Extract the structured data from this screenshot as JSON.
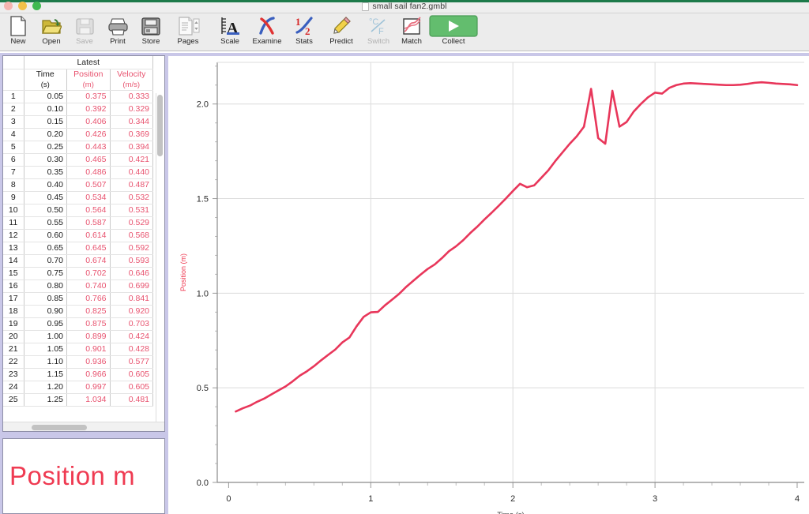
{
  "window": {
    "doc_title": "small sail fan2.gmbl",
    "doc_icon": "document-icon",
    "traffic_lights": [
      "close-red",
      "minimize-yellow",
      "maximize-green"
    ]
  },
  "toolbar": {
    "items": [
      {
        "label": "New",
        "icon": "new-document-icon",
        "disabled": false
      },
      {
        "label": "Open",
        "icon": "open-folder-icon",
        "disabled": false
      },
      {
        "label": "Save",
        "icon": "save-disk-icon",
        "disabled": true
      },
      {
        "label": "Print",
        "icon": "printer-icon",
        "disabled": false
      },
      {
        "label": "Store",
        "icon": "store-drive-icon",
        "disabled": false
      },
      {
        "label": "Pages",
        "icon": "pages-stepper-icon",
        "disabled": false
      },
      {
        "label": "Scale",
        "icon": "scale-axis-icon",
        "disabled": false
      },
      {
        "label": "Examine",
        "icon": "examine-cross-icon",
        "disabled": false
      },
      {
        "label": "Stats",
        "icon": "stats-half-icon",
        "disabled": false
      },
      {
        "label": "Predict",
        "icon": "pencil-icon",
        "disabled": false
      },
      {
        "label": "Switch",
        "icon": "switch-units-icon",
        "disabled": true
      },
      {
        "label": "Match",
        "icon": "match-graph-icon",
        "disabled": false
      },
      {
        "label": "Collect",
        "icon": "play-collect-icon",
        "disabled": false
      }
    ]
  },
  "table": {
    "group_header": "Latest",
    "columns": [
      {
        "name": "Time",
        "unit": "(s)",
        "color": "#1a1a1a"
      },
      {
        "name": "Position",
        "unit": "(m)",
        "color": "#e8536f"
      },
      {
        "name": "Velocity",
        "unit": "(m/s)",
        "color": "#e8536f"
      }
    ],
    "rows": [
      {
        "n": "1",
        "time": "0.05",
        "position": "0.375",
        "velocity": "0.333"
      },
      {
        "n": "2",
        "time": "0.10",
        "position": "0.392",
        "velocity": "0.329"
      },
      {
        "n": "3",
        "time": "0.15",
        "position": "0.406",
        "velocity": "0.344"
      },
      {
        "n": "4",
        "time": "0.20",
        "position": "0.426",
        "velocity": "0.369"
      },
      {
        "n": "5",
        "time": "0.25",
        "position": "0.443",
        "velocity": "0.394"
      },
      {
        "n": "6",
        "time": "0.30",
        "position": "0.465",
        "velocity": "0.421"
      },
      {
        "n": "7",
        "time": "0.35",
        "position": "0.486",
        "velocity": "0.440"
      },
      {
        "n": "8",
        "time": "0.40",
        "position": "0.507",
        "velocity": "0.487"
      },
      {
        "n": "9",
        "time": "0.45",
        "position": "0.534",
        "velocity": "0.532"
      },
      {
        "n": "10",
        "time": "0.50",
        "position": "0.564",
        "velocity": "0.531"
      },
      {
        "n": "11",
        "time": "0.55",
        "position": "0.587",
        "velocity": "0.529"
      },
      {
        "n": "12",
        "time": "0.60",
        "position": "0.614",
        "velocity": "0.568"
      },
      {
        "n": "13",
        "time": "0.65",
        "position": "0.645",
        "velocity": "0.592"
      },
      {
        "n": "14",
        "time": "0.70",
        "position": "0.674",
        "velocity": "0.593"
      },
      {
        "n": "15",
        "time": "0.75",
        "position": "0.702",
        "velocity": "0.646"
      },
      {
        "n": "16",
        "time": "0.80",
        "position": "0.740",
        "velocity": "0.699"
      },
      {
        "n": "17",
        "time": "0.85",
        "position": "0.766",
        "velocity": "0.841"
      },
      {
        "n": "18",
        "time": "0.90",
        "position": "0.825",
        "velocity": "0.920"
      },
      {
        "n": "19",
        "time": "0.95",
        "position": "0.875",
        "velocity": "0.703"
      },
      {
        "n": "20",
        "time": "1.00",
        "position": "0.899",
        "velocity": "0.424"
      },
      {
        "n": "21",
        "time": "1.05",
        "position": "0.901",
        "velocity": "0.428"
      },
      {
        "n": "22",
        "time": "1.10",
        "position": "0.936",
        "velocity": "0.577"
      },
      {
        "n": "23",
        "time": "1.15",
        "position": "0.966",
        "velocity": "0.605"
      },
      {
        "n": "24",
        "time": "1.20",
        "position": "0.997",
        "velocity": "0.605"
      },
      {
        "n": "25",
        "time": "1.25",
        "position": "1.034",
        "velocity": "0.481"
      }
    ]
  },
  "meter": {
    "label": "Position  m",
    "color": "#ef3b52"
  },
  "chart_data": {
    "type": "line",
    "title": "",
    "xlabel": "Time (s)",
    "ylabel": "Position (m)",
    "xlim": [
      -0.08,
      4.05
    ],
    "ylim": [
      0.0,
      2.22
    ],
    "xticks": [
      "0",
      "1",
      "2",
      "3",
      "4"
    ],
    "xtick_values": [
      0,
      1,
      2,
      3,
      4
    ],
    "yticks": [
      "0.0",
      "0.5",
      "1.0",
      "1.5",
      "2.0"
    ],
    "ytick_values": [
      0.0,
      0.5,
      1.0,
      1.5,
      2.0
    ],
    "grid": true,
    "legend": "none",
    "series": [
      {
        "name": "Position",
        "color": "#e8365a",
        "x": [
          0.05,
          0.1,
          0.15,
          0.2,
          0.25,
          0.3,
          0.35,
          0.4,
          0.45,
          0.5,
          0.55,
          0.6,
          0.65,
          0.7,
          0.75,
          0.8,
          0.85,
          0.9,
          0.95,
          1.0,
          1.05,
          1.1,
          1.15,
          1.2,
          1.25,
          1.3,
          1.35,
          1.4,
          1.45,
          1.5,
          1.55,
          1.6,
          1.65,
          1.7,
          1.75,
          1.8,
          1.85,
          1.9,
          1.95,
          2.0,
          2.05,
          2.1,
          2.15,
          2.2,
          2.25,
          2.3,
          2.35,
          2.4,
          2.45,
          2.5,
          2.55,
          2.6,
          2.65,
          2.7,
          2.75,
          2.8,
          2.85,
          2.9,
          2.95,
          3.0,
          3.05,
          3.1,
          3.15,
          3.2,
          3.25,
          3.3,
          3.35,
          3.4,
          3.45,
          3.5,
          3.55,
          3.6,
          3.65,
          3.7,
          3.75,
          3.8,
          3.85,
          3.9,
          3.95,
          4.0
        ],
        "y": [
          0.375,
          0.392,
          0.406,
          0.426,
          0.443,
          0.465,
          0.486,
          0.507,
          0.534,
          0.564,
          0.587,
          0.614,
          0.645,
          0.674,
          0.702,
          0.74,
          0.766,
          0.825,
          0.875,
          0.899,
          0.901,
          0.936,
          0.966,
          0.997,
          1.034,
          1.066,
          1.098,
          1.128,
          1.152,
          1.185,
          1.222,
          1.248,
          1.28,
          1.318,
          1.352,
          1.39,
          1.425,
          1.462,
          1.5,
          1.54,
          1.578,
          1.56,
          1.57,
          1.61,
          1.65,
          1.7,
          1.745,
          1.79,
          1.83,
          1.88,
          2.08,
          1.82,
          1.79,
          2.07,
          1.88,
          1.905,
          1.96,
          2.0,
          2.035,
          2.06,
          2.055,
          2.085,
          2.1,
          2.108,
          2.11,
          2.108,
          2.106,
          2.104,
          2.102,
          2.1,
          2.1,
          2.102,
          2.106,
          2.112,
          2.115,
          2.112,
          2.108,
          2.106,
          2.104,
          2.1
        ]
      }
    ]
  }
}
